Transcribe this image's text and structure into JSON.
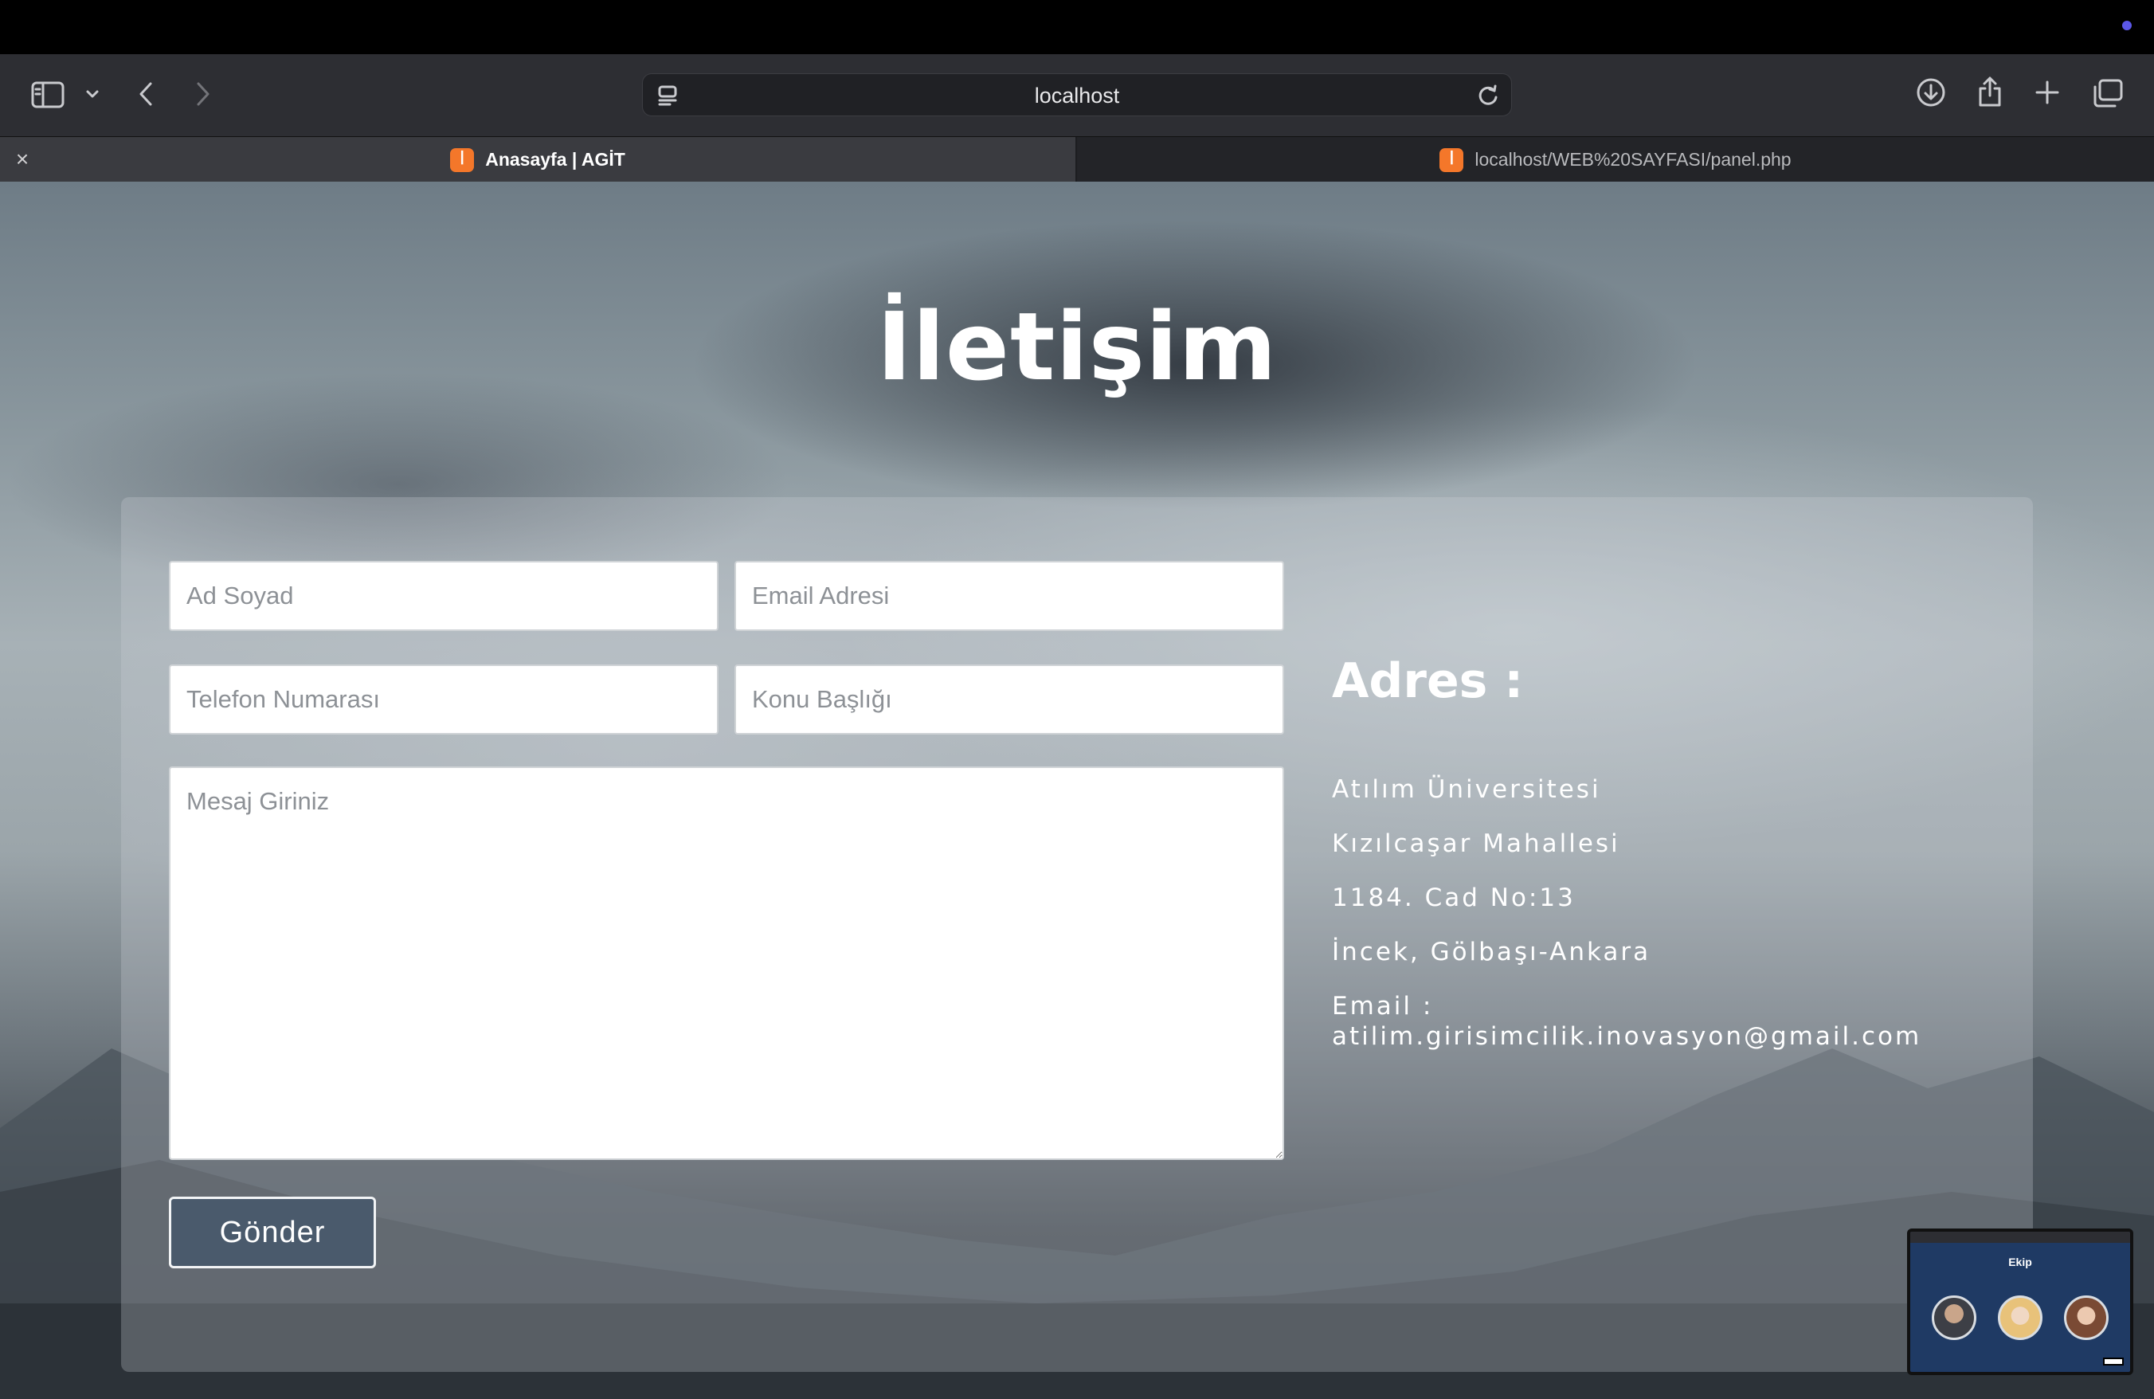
{
  "browser": {
    "url": "localhost",
    "tabs": [
      {
        "label": "Anasayfa | AGİT",
        "active": true
      },
      {
        "label": "localhost/WEB%20SAYFASI/panel.php",
        "active": false
      }
    ]
  },
  "page": {
    "title": "İletişim",
    "form": {
      "name_placeholder": "Ad Soyad",
      "email_placeholder": "Email Adresi",
      "phone_placeholder": "Telefon Numarası",
      "subject_placeholder": "Konu Başlığı",
      "message_placeholder": "Mesaj Giriniz",
      "submit_label": "Gönder"
    },
    "address": {
      "title": "Adres :",
      "lines": [
        "Atılım Üniversitesi",
        "Kızılcaşar Mahallesi",
        "1184. Cad No:13",
        "İncek, Gölbaşı-Ankara"
      ],
      "email_label": "Email :",
      "email": "atilim.girisimcilik.inovasyon@gmail.com"
    }
  },
  "thumbnail": {
    "title": "Ekip"
  },
  "colors": {
    "accent_button": "#4a5a6c",
    "favicon": "#f4772a",
    "menu_dot": "#5b57e8"
  },
  "icons": [
    "sidebar-icon",
    "chevron-down-icon",
    "back-icon",
    "forward-icon",
    "reader-icon",
    "reload-icon",
    "download-icon",
    "share-icon",
    "new-tab-icon",
    "tab-overview-icon",
    "close-icon"
  ]
}
